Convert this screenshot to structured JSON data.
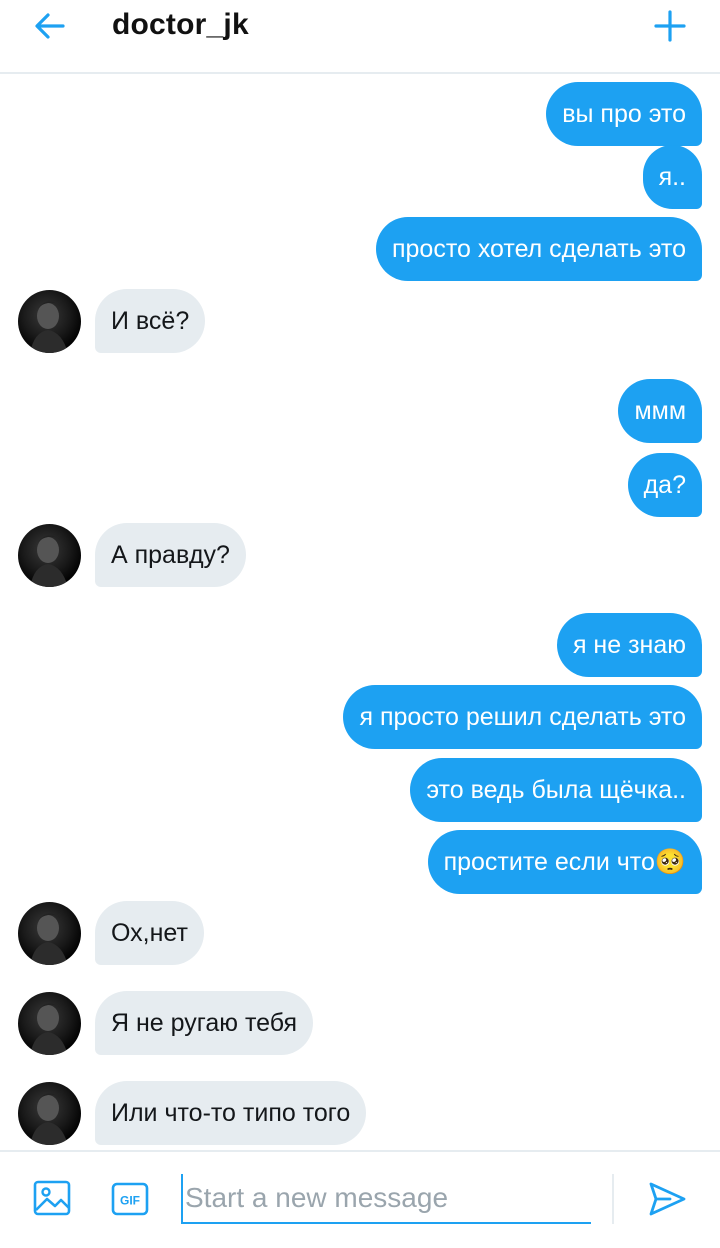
{
  "header": {
    "title": "doctor_jk",
    "back_icon": "arrow-left-icon",
    "add_icon": "plus-icon"
  },
  "colors": {
    "accent": "#1da1f2",
    "received_bubble": "#e6ecf0",
    "divider": "#e6ecf0"
  },
  "messages": [
    {
      "from": "me",
      "text": "вы про это"
    },
    {
      "from": "me",
      "text": "я.."
    },
    {
      "from": "me",
      "text": "просто хотел сделать это"
    },
    {
      "from": "them",
      "text": "И всё?"
    },
    {
      "from": "me",
      "text": "ммм"
    },
    {
      "from": "me",
      "text": "да?"
    },
    {
      "from": "them",
      "text": "А правду?"
    },
    {
      "from": "me",
      "text": "я не знаю"
    },
    {
      "from": "me",
      "text": "я просто решил сделать это"
    },
    {
      "from": "me",
      "text": "это ведь была щёчка.."
    },
    {
      "from": "me",
      "text": "простите если что🥺"
    },
    {
      "from": "them",
      "text": "Ох,нет"
    },
    {
      "from": "them",
      "text": "Я не ругаю тебя"
    },
    {
      "from": "them",
      "text": "Или что-то типо того"
    }
  ],
  "composer": {
    "placeholder": "Start a new message",
    "gif_label": "GIF",
    "image_icon": "image-icon",
    "send_icon": "send-icon"
  }
}
